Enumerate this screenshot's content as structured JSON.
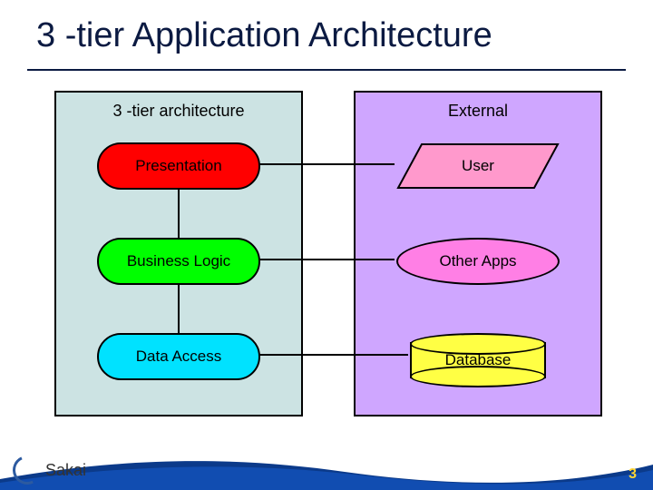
{
  "title": "3 -tier Application Architecture",
  "left": {
    "heading": "3 -tier architecture",
    "tiers": [
      "Presentation",
      "Business Logic",
      "Data Access"
    ]
  },
  "right": {
    "heading": "External",
    "items": [
      "User",
      "Other Apps",
      "Database"
    ]
  },
  "logo": "Sakai",
  "page": "3"
}
